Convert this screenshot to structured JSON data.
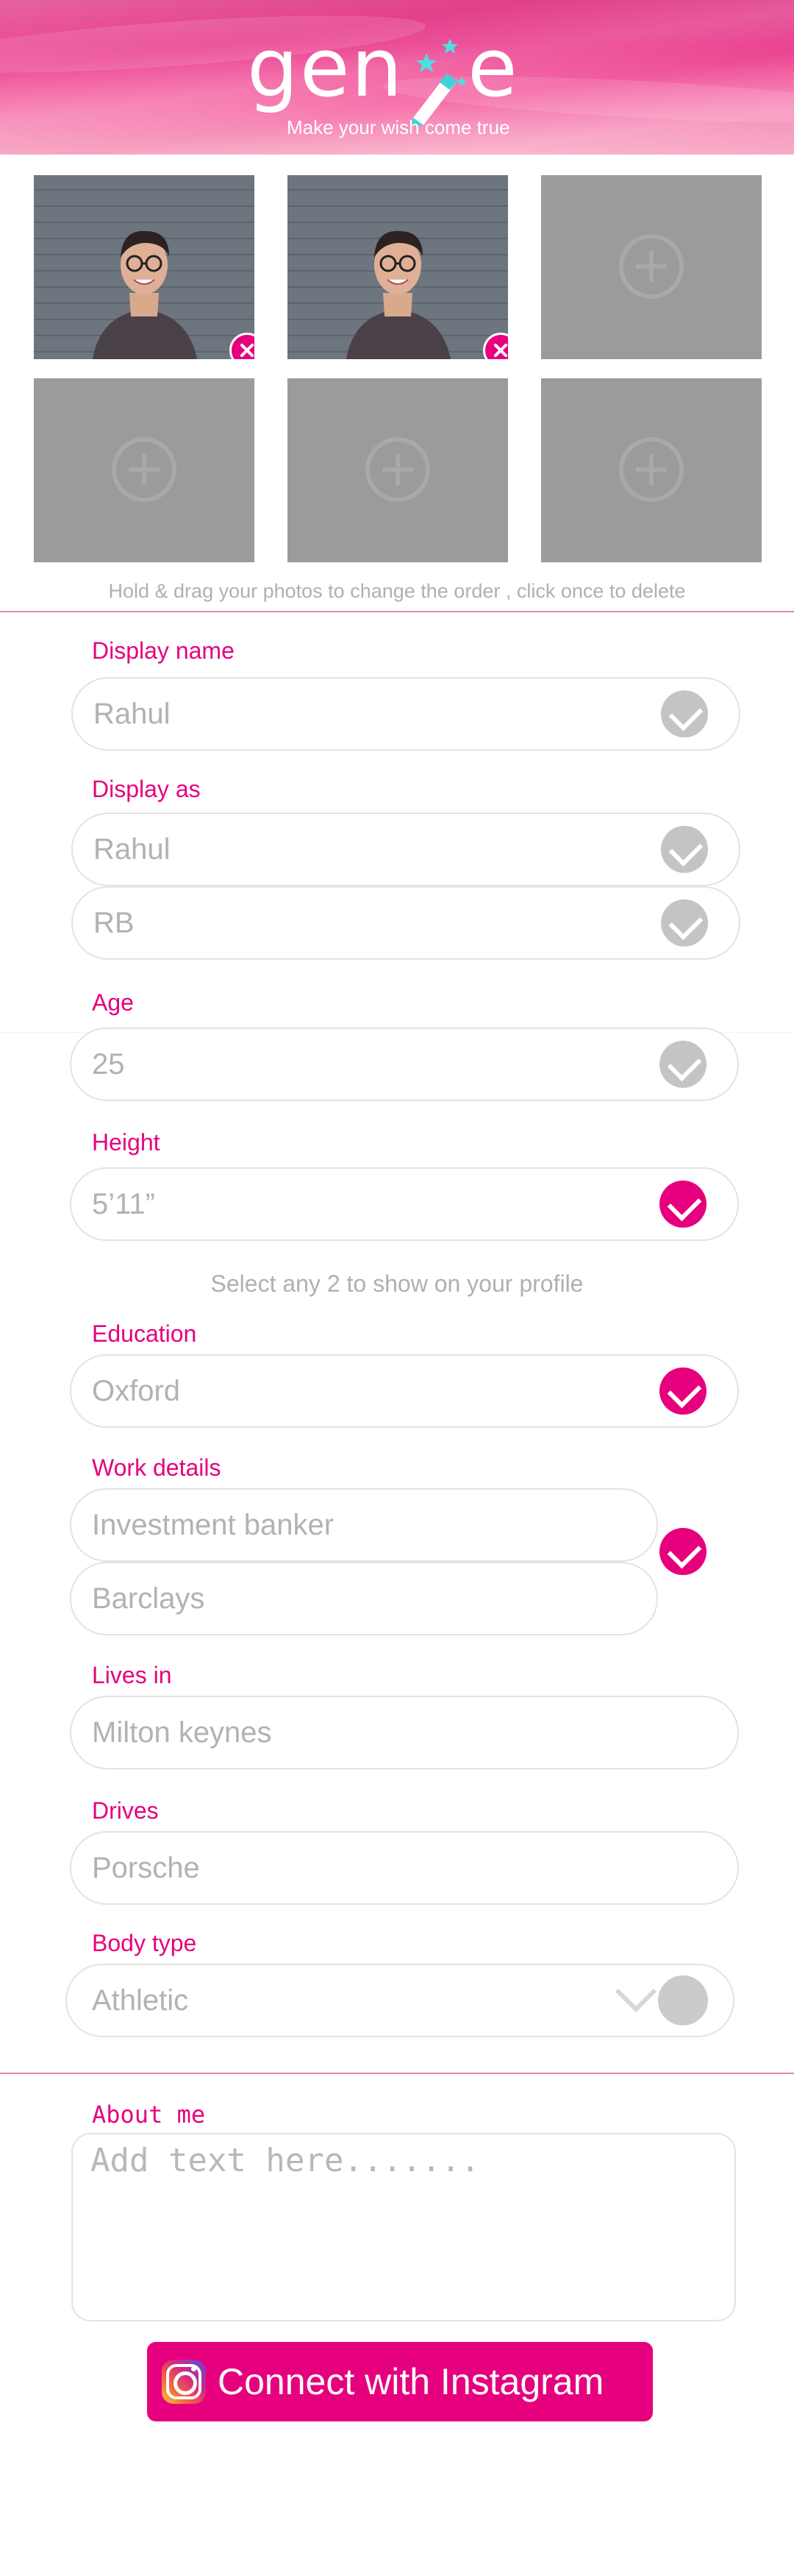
{
  "header": {
    "logo_left": "gen",
    "logo_right": "e",
    "tagline": "Make your wish come true"
  },
  "photos": {
    "hint": "Hold & drag your photos to change the order , click once to delete"
  },
  "fields": {
    "display_name": {
      "label": "Display name",
      "value": "Rahul"
    },
    "display_as": {
      "label": "Display as",
      "value1": "Rahul",
      "value2": "RB"
    },
    "age": {
      "label": "Age",
      "value": "25"
    },
    "height": {
      "label": "Height",
      "value": "5’11”"
    },
    "select_hint": "Select any 2 to show on your profile",
    "education": {
      "label": "Education",
      "value": "Oxford"
    },
    "work": {
      "label": "Work details",
      "value1": "Investment banker",
      "value2": "Barclays"
    },
    "lives_in": {
      "label": "Lives in",
      "value": "Milton keynes"
    },
    "drives": {
      "label": "Drives",
      "value": "Porsche"
    },
    "body_type": {
      "label": "Body type",
      "value": "Athletic"
    }
  },
  "about": {
    "label": "About me",
    "placeholder": "Add text here......."
  },
  "instagram": {
    "label": "Connect with Instagram"
  },
  "colors": {
    "accent": "#e6007e",
    "inactive_check": "#c4c4c4",
    "field_text": "#b2b2b2"
  }
}
